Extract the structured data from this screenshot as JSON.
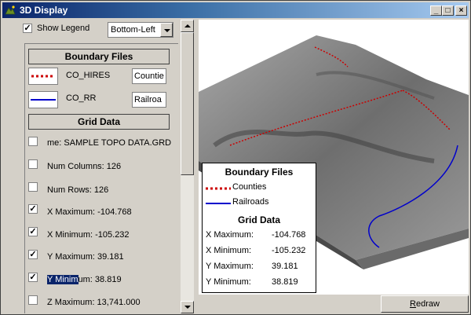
{
  "window": {
    "title": "3D Display",
    "buttons": [
      "minimize",
      "maximize",
      "close"
    ]
  },
  "legend_options": {
    "show_legend_label": "Show Legend",
    "show_legend_checked": true,
    "position_value": "Bottom-Left"
  },
  "panel": {
    "boundary_header": "Boundary Files",
    "boundary_files": [
      {
        "name": "CO_HIRES",
        "label_value": "Countie",
        "color": "#cc0000",
        "style": "dotted"
      },
      {
        "name": "CO_RR",
        "label_value": "Railroa",
        "color": "#0000cc",
        "style": "solid"
      }
    ],
    "grid_header": "Grid Data",
    "grid_items": [
      {
        "label": "me: SAMPLE TOPO DATA.GRD",
        "checked": false
      },
      {
        "label": "Num Columns: 126",
        "checked": false
      },
      {
        "label": "Num Rows: 126",
        "checked": false
      },
      {
        "label": "X Maximum: -104.768",
        "checked": true
      },
      {
        "label": "X Minimum: -105.232",
        "checked": true
      },
      {
        "label": "Y Maximum: 39.181",
        "checked": true
      },
      {
        "label_selected": "Y Minim",
        "label_rest": "um: 38.819",
        "checked": true
      },
      {
        "label": "Z Maximum: 13,741.000",
        "checked": false
      }
    ]
  },
  "map_legend": {
    "boundary_title": "Boundary Files",
    "entries": [
      {
        "label": "Counties",
        "color": "#cc0000",
        "style": "dotted"
      },
      {
        "label": "Railroads",
        "color": "#0000cc",
        "style": "solid"
      }
    ],
    "grid_title": "Grid Data",
    "rows": [
      {
        "key": "X Maximum:",
        "value": "-104.768"
      },
      {
        "key": "X Minimum:",
        "value": "-105.232"
      },
      {
        "key": "Y Maximum:",
        "value": "39.181"
      },
      {
        "key": "Y Minimum:",
        "value": "38.819"
      }
    ]
  },
  "redraw": {
    "label_underlined": "R",
    "label_rest": "edraw"
  }
}
